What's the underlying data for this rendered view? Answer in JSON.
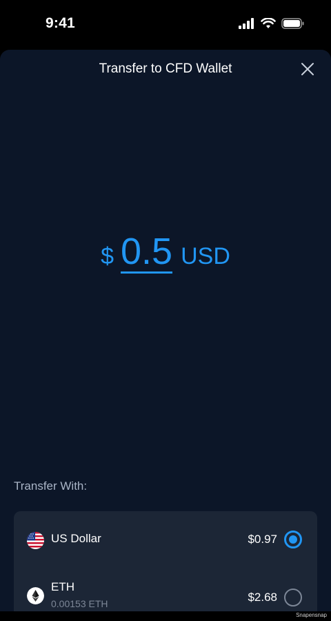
{
  "status_bar": {
    "time": "9:41"
  },
  "sheet": {
    "title": "Transfer to CFD Wallet",
    "close_icon": "close-icon"
  },
  "amount": {
    "symbol": "$",
    "value": "0.5",
    "currency": "USD",
    "accent_color": "#2196f3"
  },
  "transfer_with": {
    "label": "Transfer With:",
    "options": [
      {
        "name": "US Dollar",
        "value": "$0.97",
        "icon": "us-flag-icon",
        "selected": true
      },
      {
        "name": "ETH",
        "sub": "0.00153 ETH",
        "value": "$2.68",
        "icon": "ethereum-icon",
        "selected": false
      }
    ]
  },
  "watermark": "Snapensnap"
}
